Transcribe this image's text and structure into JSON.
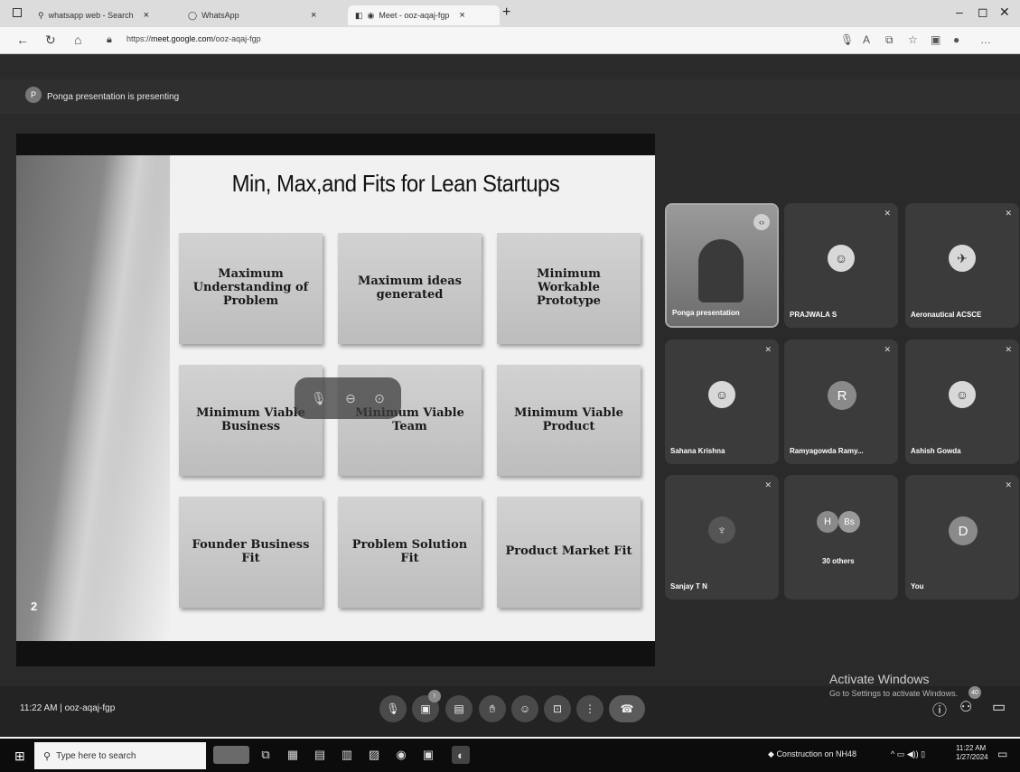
{
  "browser": {
    "tabs": [
      {
        "label": "whatsapp web - Search"
      },
      {
        "label": "WhatsApp"
      },
      {
        "label": "Meet - ooz-aqaj-fgp"
      }
    ],
    "url_prefix": "https://",
    "url_host": "meet.google.com",
    "url_path": "/ooz-aqaj-fgp"
  },
  "meet": {
    "presenting_avatar": "P",
    "presenting_text": "Ponga presentation is presenting",
    "meeting_time": "11:22 AM",
    "meeting_code": "ooz-aqaj-fgp",
    "participant_count_badge": "40",
    "people_count": "0"
  },
  "slide": {
    "title": "Min, Max,and Fits for Lean Startups",
    "page_number": "2",
    "cards": [
      "Maximum Understanding of Problem",
      "Maximum ideas generated",
      "Minimum Workable Prototype",
      "Minimum Viable Business",
      "Minimum Viable Team",
      "Minimum Viable Product",
      "Founder Business Fit",
      "Problem Solution Fit",
      "Product Market Fit"
    ]
  },
  "participants": [
    {
      "name": "Ponga presentation",
      "type": "video"
    },
    {
      "name": "PRAJWALA S",
      "type": "photo"
    },
    {
      "name": "Aeronautical ACSCE",
      "type": "photo"
    },
    {
      "name": "Sahana Krishna",
      "type": "photo"
    },
    {
      "name": "Ramyagowda Ramy...",
      "type": "letter",
      "letter": "R"
    },
    {
      "name": "Ashish Gowda",
      "type": "photo"
    },
    {
      "name": "Sanjay T N",
      "type": "photo"
    },
    {
      "name": "30 others",
      "type": "group",
      "letters": [
        "H",
        "Bs"
      ]
    },
    {
      "name": "You",
      "type": "letter",
      "letter": "D"
    }
  ],
  "watermark": {
    "line1": "Activate Windows",
    "line2": "Go to Settings to activate Windows."
  },
  "taskbar": {
    "search_placeholder": "Type here to search",
    "weather": "Construction on NH48",
    "time": "11:22 AM",
    "date": "1/27/2024"
  }
}
